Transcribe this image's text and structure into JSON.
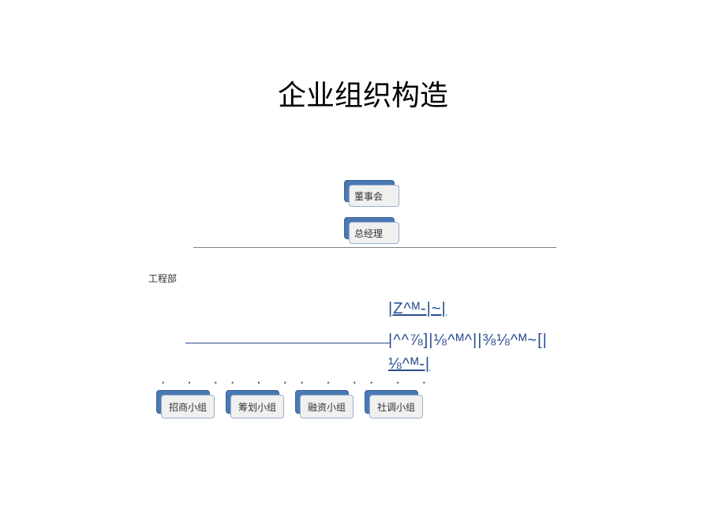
{
  "title": "企业组织构造",
  "board": "董事会",
  "gm": "总经理",
  "dept": "工程部",
  "garbled": {
    "line1": "|Z^ᴹ-|~|",
    "line2": "|^^⅞]|⅛^ᴹ^||⅜⅛^ᴹ~[|",
    "line3": "⅛^ᴹ-|"
  },
  "dots": "•  •  •",
  "teams": {
    "t1": "招商小组",
    "t2": "筹划小组",
    "t3": "融资小组",
    "t4": "社调小组"
  }
}
